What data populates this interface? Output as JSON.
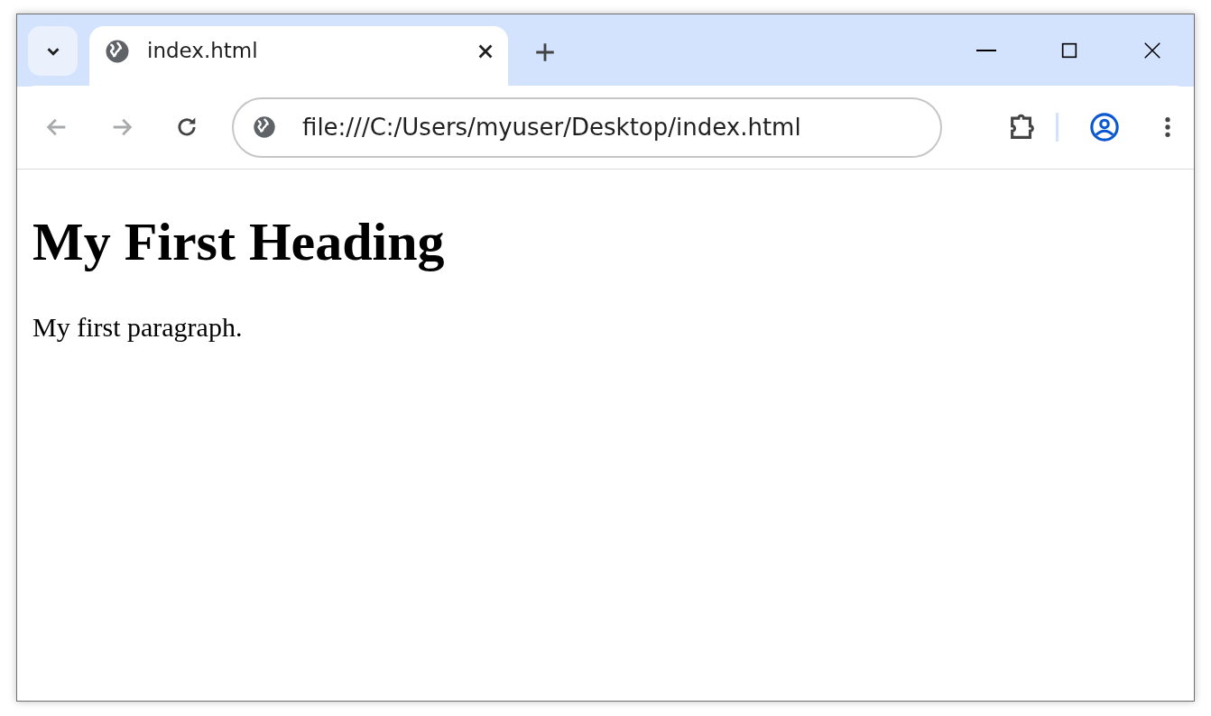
{
  "tabs": [
    {
      "title": "index.html",
      "selected": true
    }
  ],
  "toolbar": {
    "back_disabled": true,
    "forward_disabled": true
  },
  "address_bar": {
    "url": "file:///C:/Users/myuser/Desktop/index.html"
  },
  "page": {
    "heading": "My First Heading",
    "paragraph": "My first paragraph."
  }
}
